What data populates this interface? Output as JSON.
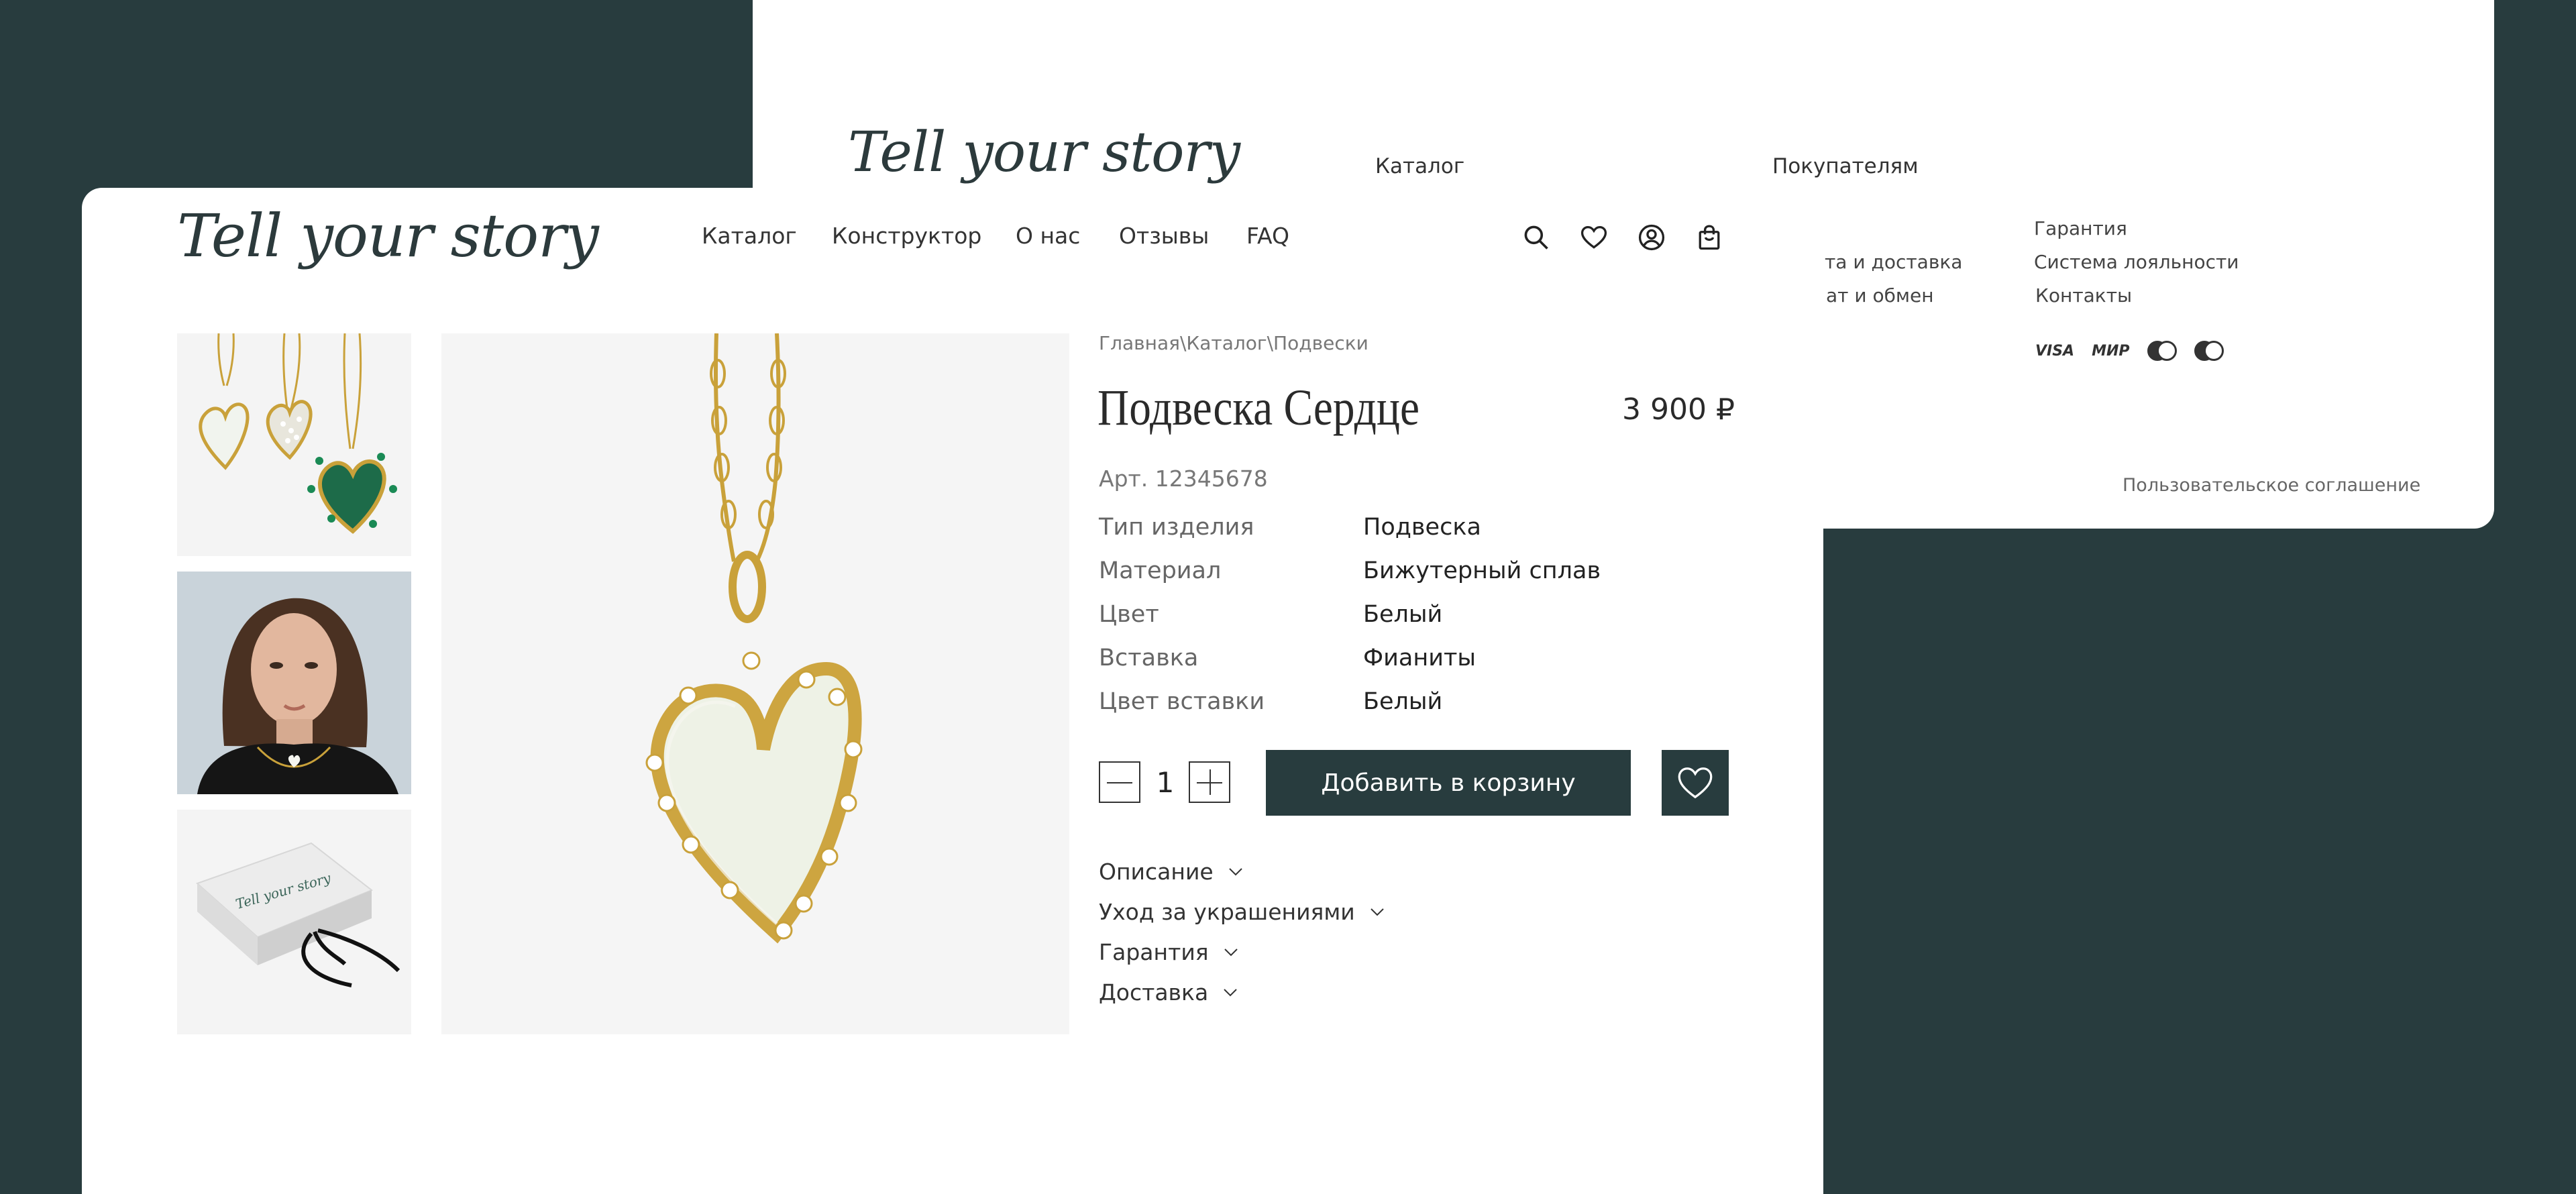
{
  "brand": {
    "logo_text": "Tell your story"
  },
  "header": {
    "nav": [
      "Каталог",
      "Конструктор",
      "О нас",
      "Отзывы",
      "FAQ"
    ],
    "icons": [
      "search-icon",
      "heart-icon",
      "user-icon",
      "bag-icon"
    ]
  },
  "product": {
    "breadcrumb": "Главная\\Каталог\\Подвески",
    "title": "Подвеска Сердце",
    "price": "3 900 ₽",
    "sku": "Арт. 12345678",
    "attributes": [
      {
        "key": "Тип изделия",
        "value": "Подвеска"
      },
      {
        "key": "Материал",
        "value": "Бижутерный сплав"
      },
      {
        "key": "Цвет",
        "value": "Белый"
      },
      {
        "key": "Вставка",
        "value": "Фианиты"
      },
      {
        "key": "Цвет вставки",
        "value": "Белый"
      }
    ],
    "quantity": "1",
    "add_to_cart_label": "Добавить в корзину",
    "accordion": [
      "Описание",
      "Уход за украшениями",
      "Гарантия",
      "Доставка"
    ],
    "box_logo_text": "Tell your story"
  },
  "footer": {
    "col1_title": "Каталог",
    "col2_title": "Покупателям",
    "col2_links": [
      "та и доставка",
      "ат и обмен"
    ],
    "col3_links": [
      "Гарантия",
      "Система лояльности",
      "Контакты"
    ],
    "payments": [
      "VISA",
      "МИР",
      "mastercard",
      "maestro"
    ],
    "agreement": "Пользовательское соглашение"
  },
  "colors": {
    "brand_dark": "#283c3e",
    "page_bg": "#283c3e",
    "gold": "#d4af37"
  }
}
